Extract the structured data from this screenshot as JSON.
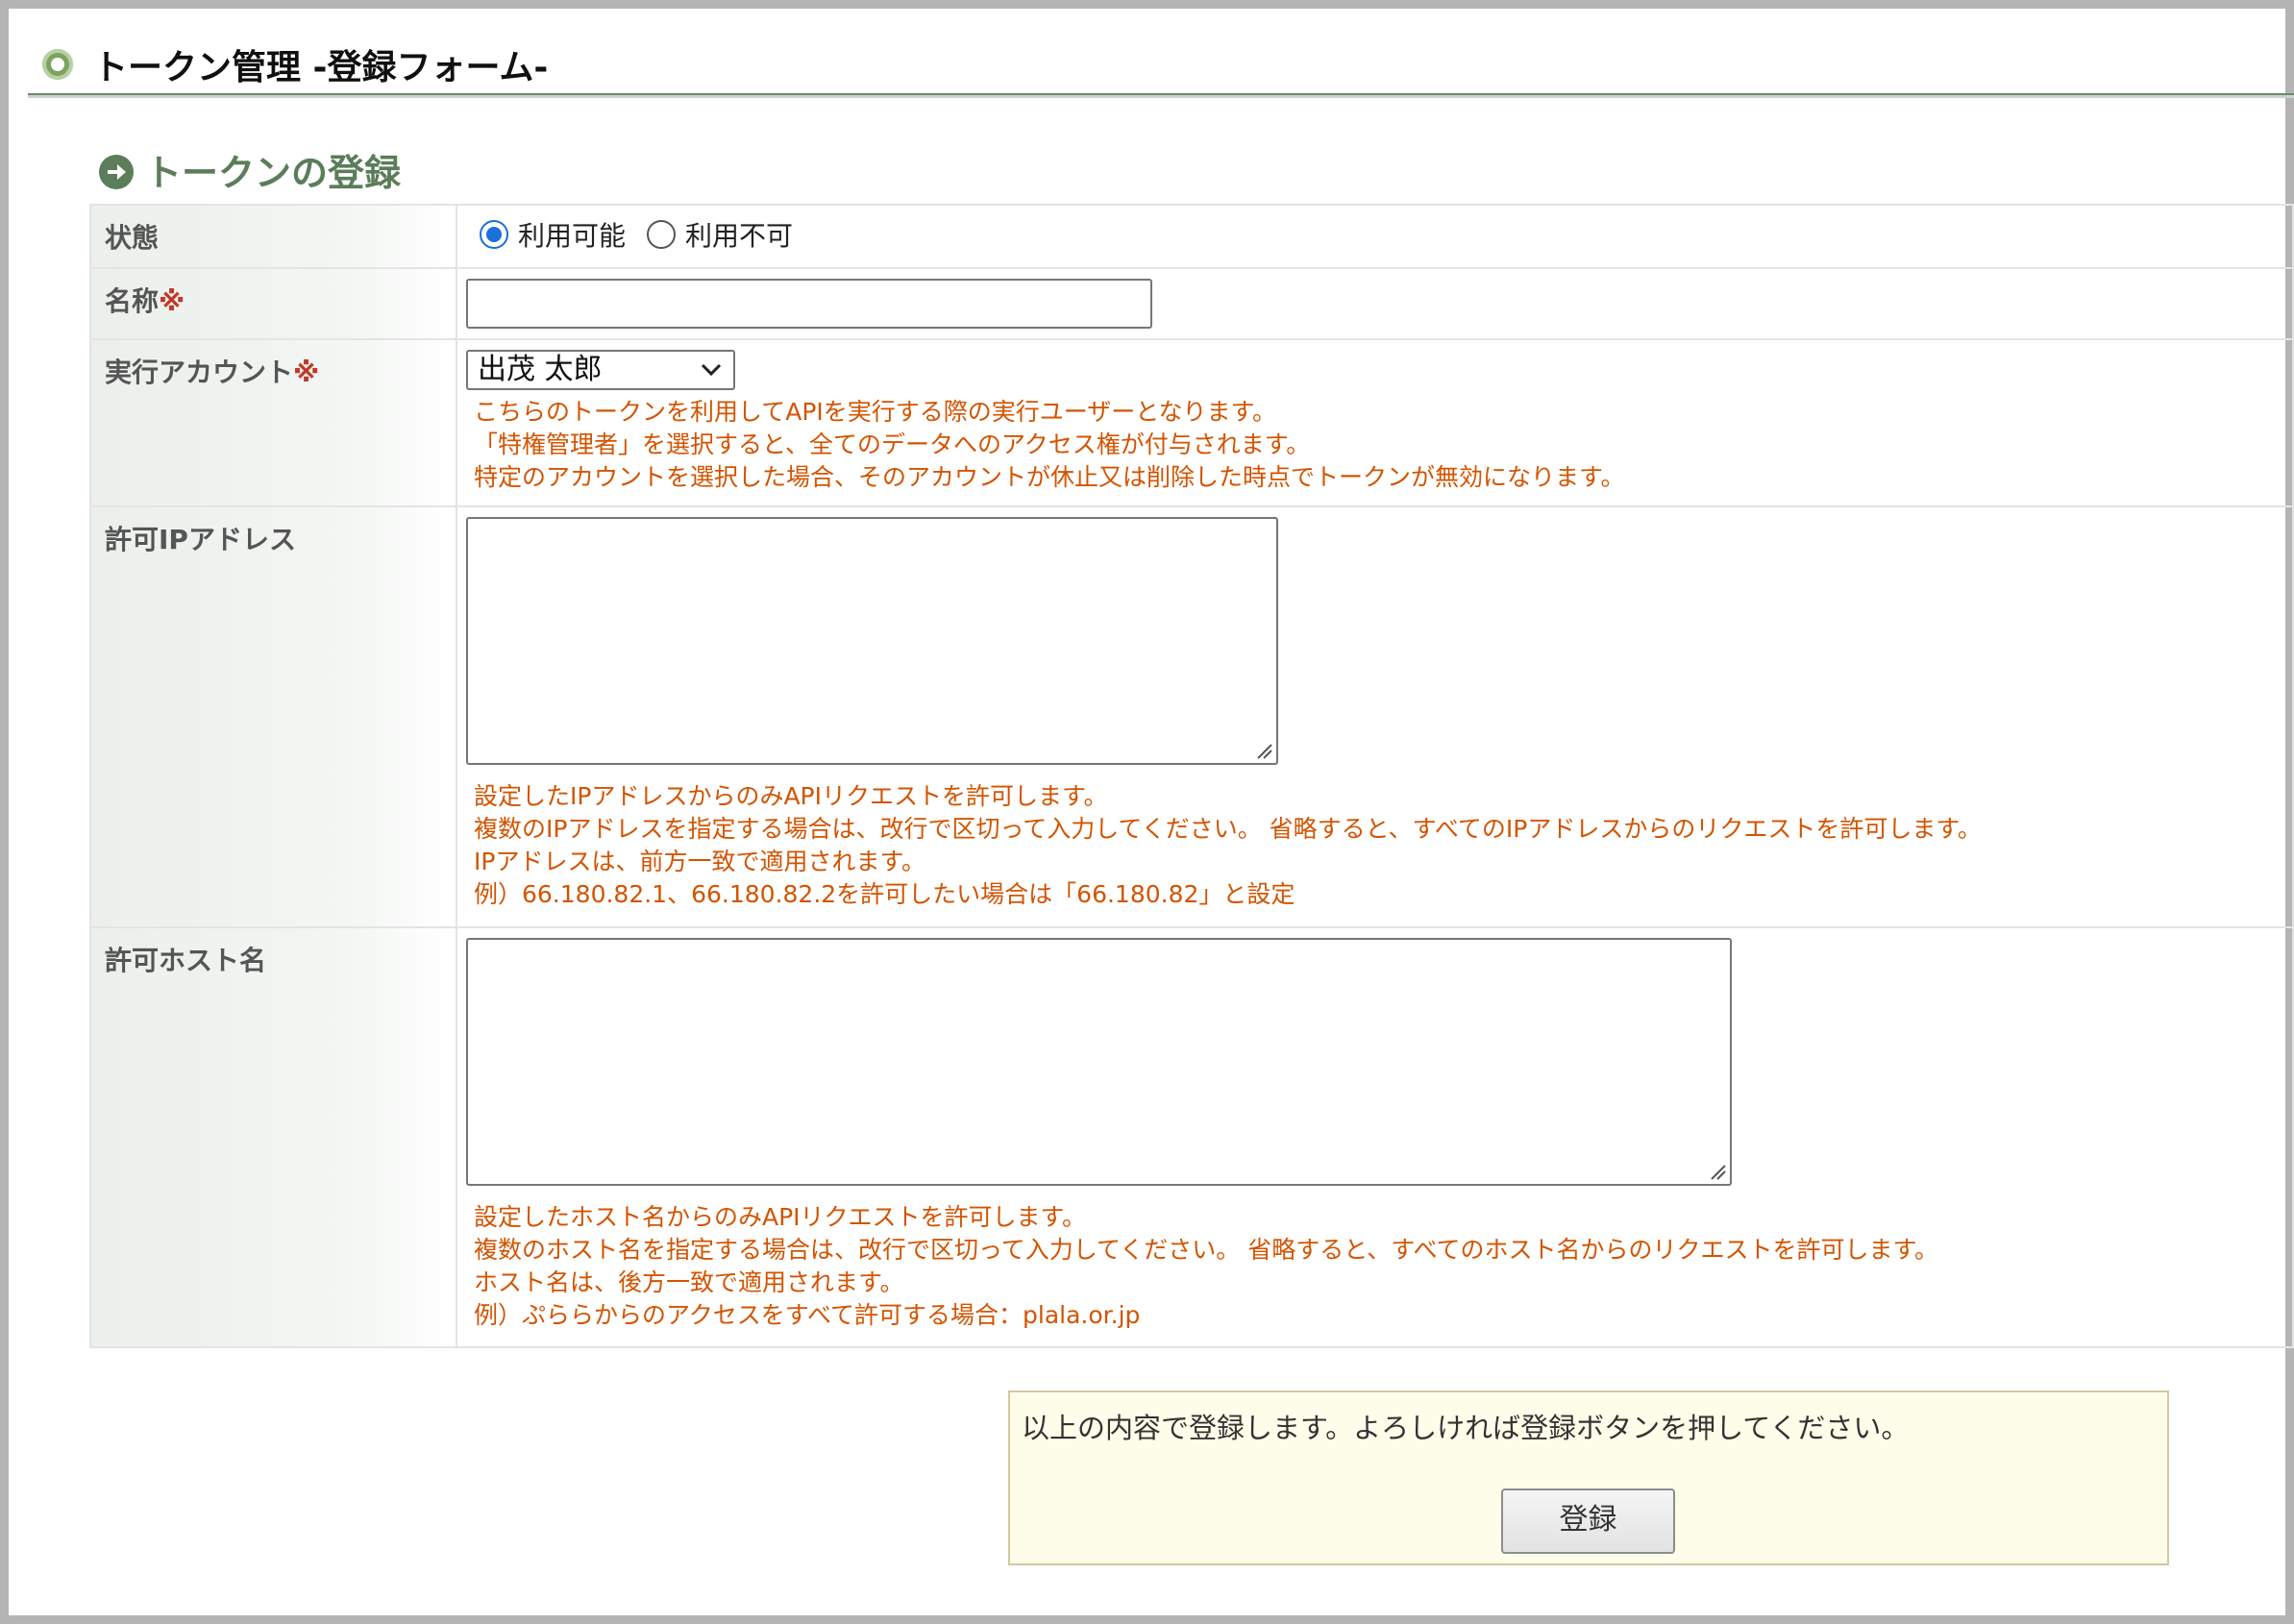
{
  "page": {
    "title": "トークン管理 -登録フォーム-"
  },
  "section": {
    "title": "トークンの登録"
  },
  "form": {
    "status": {
      "label": "状態",
      "options": [
        "利用可能",
        "利用不可"
      ],
      "selected": "利用可能"
    },
    "name": {
      "label": "名称",
      "required_mark": "※",
      "value": ""
    },
    "account": {
      "label": "実行アカウント",
      "required_mark": "※",
      "selected": "出茂 太郎",
      "notes": [
        "こちらのトークンを利用してAPIを実行する際の実行ユーザーとなります。",
        "「特権管理者」を選択すると、全てのデータへのアクセス権が付与されます。",
        "特定のアカウントを選択した場合、そのアカウントが休止又は削除した時点でトークンが無効になります。"
      ]
    },
    "allowed_ip": {
      "label": "許可IPアドレス",
      "value": "",
      "notes": [
        "設定したIPアドレスからのみAPIリクエストを許可します。",
        "複数のIPアドレスを指定する場合は、改行で区切って入力してください。 省略すると、すべてのIPアドレスからのリクエストを許可します。",
        "IPアドレスは、前方一致で適用されます。",
        "例）66.180.82.1、66.180.82.2を許可したい場合は「66.180.82」と設定"
      ]
    },
    "allowed_host": {
      "label": "許可ホスト名",
      "value": "",
      "notes": [
        "設定したホスト名からのみAPIリクエストを許可します。",
        "複数のホスト名を指定する場合は、改行で区切って入力してください。 省略すると、すべてのホスト名からのリクエストを許可します。",
        "ホスト名は、後方一致で適用されます。",
        "例）ぷららからのアクセスをすべて許可する場合：plala.or.jp"
      ]
    }
  },
  "confirm": {
    "message": "以上の内容で登録します。よろしければ登録ボタンを押してください。",
    "submit_label": "登録"
  },
  "colors": {
    "note_text": "#d35400",
    "required_mark": "#c0392b",
    "section_title": "#5b7d5a",
    "radio_selected": "#1b6fd8"
  }
}
